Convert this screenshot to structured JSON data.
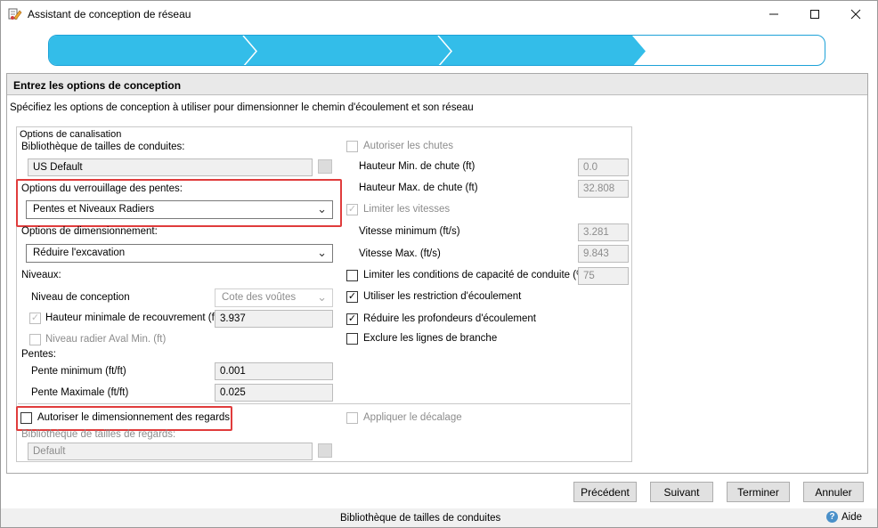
{
  "window": {
    "title": "Assistant de conception de réseau",
    "minimize": "—",
    "maximize": "☐",
    "close": "✕"
  },
  "colors": {
    "progress_fill": "#33bde9",
    "progress_border": "#1da2d8",
    "highlight": "#e03c3c"
  },
  "progress": {
    "steps_total": 4,
    "steps_completed": 3
  },
  "panel": {
    "header": "Entrez les options de conception",
    "description": "Spécifiez les options de conception à utiliser pour dimensionner le chemin d'écoulement et son réseau"
  },
  "group": {
    "caption": "Options de canalisation",
    "pipe_library_label": "Bibliothèque de tailles de conduites:",
    "pipe_library_value": "US Default",
    "slope_lock_label": "Options du verrouillage des pentes:",
    "slope_lock_value": "Pentes et Niveaux Radiers",
    "sizing_label": "Options de dimensionnement:",
    "sizing_value": "Réduire l'excavation",
    "levels_label": "Niveaux:",
    "design_level_label": "Niveau de conception",
    "design_level_value": "Cote des voûtes",
    "min_cover_label": "Hauteur minimale de recouvrement (ft)",
    "min_cover_value": "3.937",
    "min_cover_checked": true,
    "downstream_invert_label": "Niveau radier Aval Min. (ft)",
    "downstream_invert_checked": false,
    "slopes_label": "Pentes:",
    "min_slope_label": "Pente minimum (ft/ft)",
    "min_slope_value": "0.001",
    "max_slope_label": "Pente Maximale (ft/ft)",
    "max_slope_value": "0.025",
    "allow_drops_label": "Autoriser les chutes",
    "allow_drops_checked": false,
    "drop_min_label": "Hauteur Min. de chute (ft)",
    "drop_min_value": "0.0",
    "drop_max_label": "Hauteur Max. de chute (ft)",
    "drop_max_value": "32.808",
    "limit_velocity_label": "Limiter les vitesses",
    "limit_velocity_checked": true,
    "velocity_min_label": "Vitesse minimum (ft/s)",
    "velocity_min_value": "3.281",
    "velocity_max_label": "Vitesse Max. (ft/s)",
    "velocity_max_value": "9.843",
    "limit_capacity_label": "Limiter les conditions de capacité de conduite (%)",
    "limit_capacity_checked": false,
    "limit_capacity_value": "75",
    "use_restriction_label": "Utiliser les restriction d'écoulement",
    "use_restriction_checked": true,
    "reduce_depth_label": "Réduire les profondeurs d'écoulement",
    "reduce_depth_checked": true,
    "exclude_branch_label": "Exclure les lignes de branche",
    "exclude_branch_checked": false,
    "allow_structure_sizing_label": "Autoriser le dimensionnement des regards",
    "allow_structure_sizing_checked": false,
    "structure_library_label": "Bibliothèque de tailles de regards:",
    "structure_library_value": "Default",
    "apply_offset_label": "Appliquer le décalage",
    "apply_offset_checked": false
  },
  "buttons": {
    "previous": "Précédent",
    "next": "Suivant",
    "finish": "Terminer",
    "cancel": "Annuler"
  },
  "status": {
    "text": "Bibliothèque de tailles de conduites",
    "help": "Aide",
    "help_icon": "question-icon"
  },
  "icons": {
    "dropdown": "▾",
    "check": "✓"
  }
}
